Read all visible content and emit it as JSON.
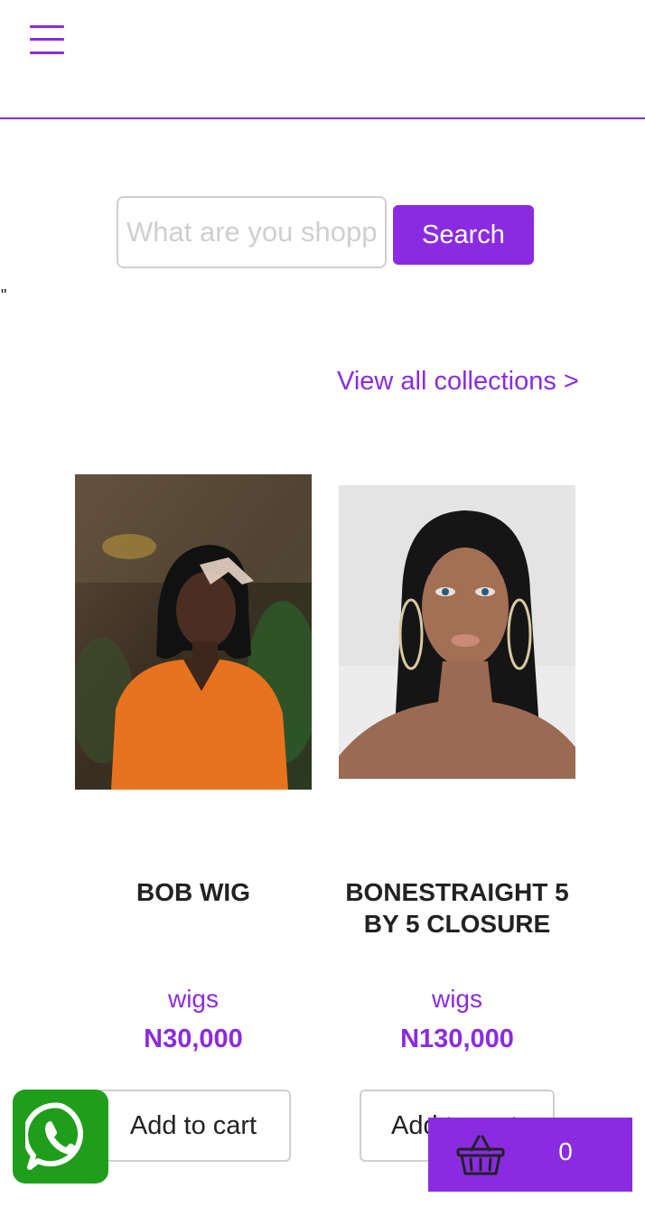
{
  "header": {
    "menu_icon": "hamburger-menu-icon"
  },
  "search": {
    "placeholder": "What are you shopping for?",
    "value": "",
    "button_label": "Search"
  },
  "stray_text": "\"",
  "collections_link": "View all collections >",
  "products": [
    {
      "title": "BOB WIG",
      "category": "wigs",
      "price": "N30,000",
      "cart_label": "Add to cart"
    },
    {
      "title": "BONESTRAIGHT 5 BY 5 CLOSURE",
      "category": "wigs",
      "price": "N130,000",
      "cart_label": "Add to cart"
    }
  ],
  "whatsapp": {
    "icon": "whatsapp-icon"
  },
  "basket": {
    "icon": "basket-icon",
    "count": "0"
  },
  "colors": {
    "accent": "#8a2be2",
    "whatsapp_green": "#1f9e1b",
    "border_gray": "#cfcfcf"
  }
}
